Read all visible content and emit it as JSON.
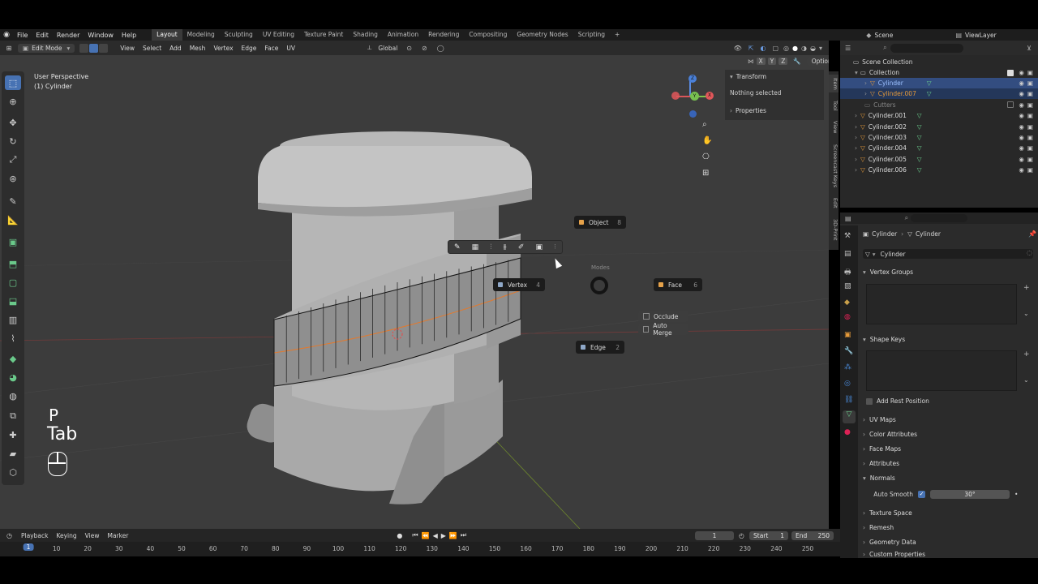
{
  "topbar": {
    "menus": [
      "File",
      "Edit",
      "Render",
      "Window",
      "Help"
    ],
    "workspaces": [
      "Layout",
      "Modeling",
      "Sculpting",
      "UV Editing",
      "Texture Paint",
      "Shading",
      "Animation",
      "Rendering",
      "Compositing",
      "Geometry Nodes",
      "Scripting"
    ],
    "active_workspace": "Layout",
    "add_tab": "+",
    "scene": "Scene",
    "view_layer": "ViewLayer"
  },
  "header": {
    "mode": "Edit Mode",
    "menus": [
      "View",
      "Select",
      "Add",
      "Mesh",
      "Vertex",
      "Edge",
      "Face",
      "UV"
    ],
    "orientation": "Global",
    "options": "Options",
    "axes": [
      "X",
      "Y",
      "Z"
    ]
  },
  "viewport": {
    "perspective": "User Perspective",
    "object": "(1) Cylinder",
    "key_p": "P",
    "key_tab": "Tab",
    "pie": {
      "title": "Modes",
      "object": "Object",
      "object_num": "8",
      "vertex": "Vertex",
      "vertex_num": "4",
      "face": "Face",
      "face_num": "6",
      "edge": "Edge",
      "edge_num": "2",
      "occlude": "Occlude",
      "auto_merge": "Auto Merge"
    },
    "gizmo": {
      "z": "Z",
      "x": "X",
      "y": "Y"
    }
  },
  "npanel": {
    "transform": "Transform",
    "nothing_selected": "Nothing selected",
    "properties": "Properties",
    "tabs": [
      "Item",
      "Tool",
      "View",
      "Screencast Keys",
      "Edit",
      "3D-Print"
    ]
  },
  "outliner": {
    "scene_collection": "Scene Collection",
    "collection": "Collection",
    "items": [
      {
        "name": "Cylinder",
        "level": 2,
        "state": "selected"
      },
      {
        "name": "Cylinder.007",
        "level": 2,
        "state": "secondary"
      },
      {
        "name": "Cutters",
        "level": 1,
        "state": "dim"
      },
      {
        "name": "Cylinder.001",
        "level": 1,
        "state": ""
      },
      {
        "name": "Cylinder.002",
        "level": 1,
        "state": ""
      },
      {
        "name": "Cylinder.003",
        "level": 1,
        "state": ""
      },
      {
        "name": "Cylinder.004",
        "level": 1,
        "state": ""
      },
      {
        "name": "Cylinder.005",
        "level": 1,
        "state": ""
      },
      {
        "name": "Cylinder.006",
        "level": 1,
        "state": ""
      }
    ]
  },
  "properties": {
    "breadcrumb_obj": "Cylinder",
    "breadcrumb_mesh": "Cylinder",
    "mesh_name": "Cylinder",
    "vertex_groups": "Vertex Groups",
    "shape_keys": "Shape Keys",
    "add_rest_position": "Add Rest Position",
    "uv_maps": "UV Maps",
    "color_attributes": "Color Attributes",
    "face_maps": "Face Maps",
    "attributes": "Attributes",
    "normals": "Normals",
    "auto_smooth": "Auto Smooth",
    "auto_smooth_angle": "30°",
    "texture_space": "Texture Space",
    "remesh": "Remesh",
    "geometry_data": "Geometry Data",
    "custom_properties": "Custom Properties"
  },
  "timeline": {
    "menus": [
      "Playback",
      "Keying",
      "View",
      "Marker"
    ],
    "current_frame": "1",
    "start_label": "Start",
    "start": "1",
    "end_label": "End",
    "end": "250",
    "frames": [
      "1",
      "10",
      "20",
      "30",
      "40",
      "50",
      "60",
      "70",
      "80",
      "90",
      "100",
      "110",
      "120",
      "130",
      "140",
      "150",
      "160",
      "170",
      "180",
      "190",
      "200",
      "210",
      "220",
      "230",
      "240",
      "250"
    ]
  }
}
